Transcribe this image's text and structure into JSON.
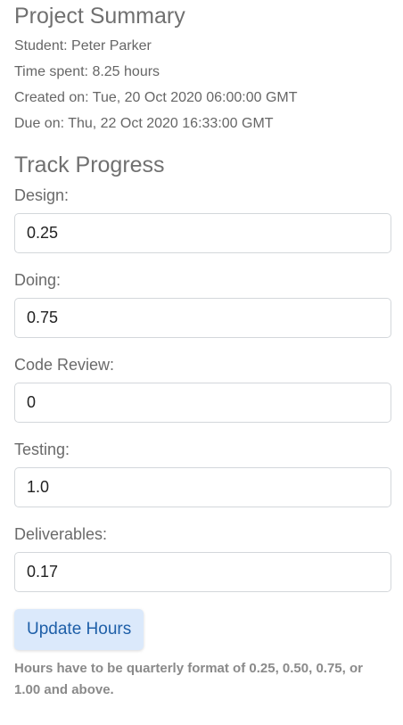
{
  "summary": {
    "title": "Project Summary",
    "student": "Student: Peter Parker",
    "time_spent": "Time spent: 8.25 hours",
    "created_on": "Created on: Tue, 20 Oct 2020 06:00:00 GMT",
    "due_on": "Due on: Thu, 22 Oct 2020 16:33:00 GMT"
  },
  "progress": {
    "title": "Track Progress",
    "fields": [
      {
        "label": "Design:",
        "value": "0.25"
      },
      {
        "label": "Doing:",
        "value": "0.75"
      },
      {
        "label": "Code Review:",
        "value": "0"
      },
      {
        "label": "Testing:",
        "value": "1.0"
      },
      {
        "label": "Deliverables:",
        "value": "0.17"
      }
    ],
    "update_button": "Update Hours",
    "hint": "Hours have to be quarterly format of 0.25, 0.50, 0.75, or 1.00 and above."
  },
  "colors": {
    "button_bg": "#dbe9fb",
    "button_text": "#1e5fa8"
  }
}
